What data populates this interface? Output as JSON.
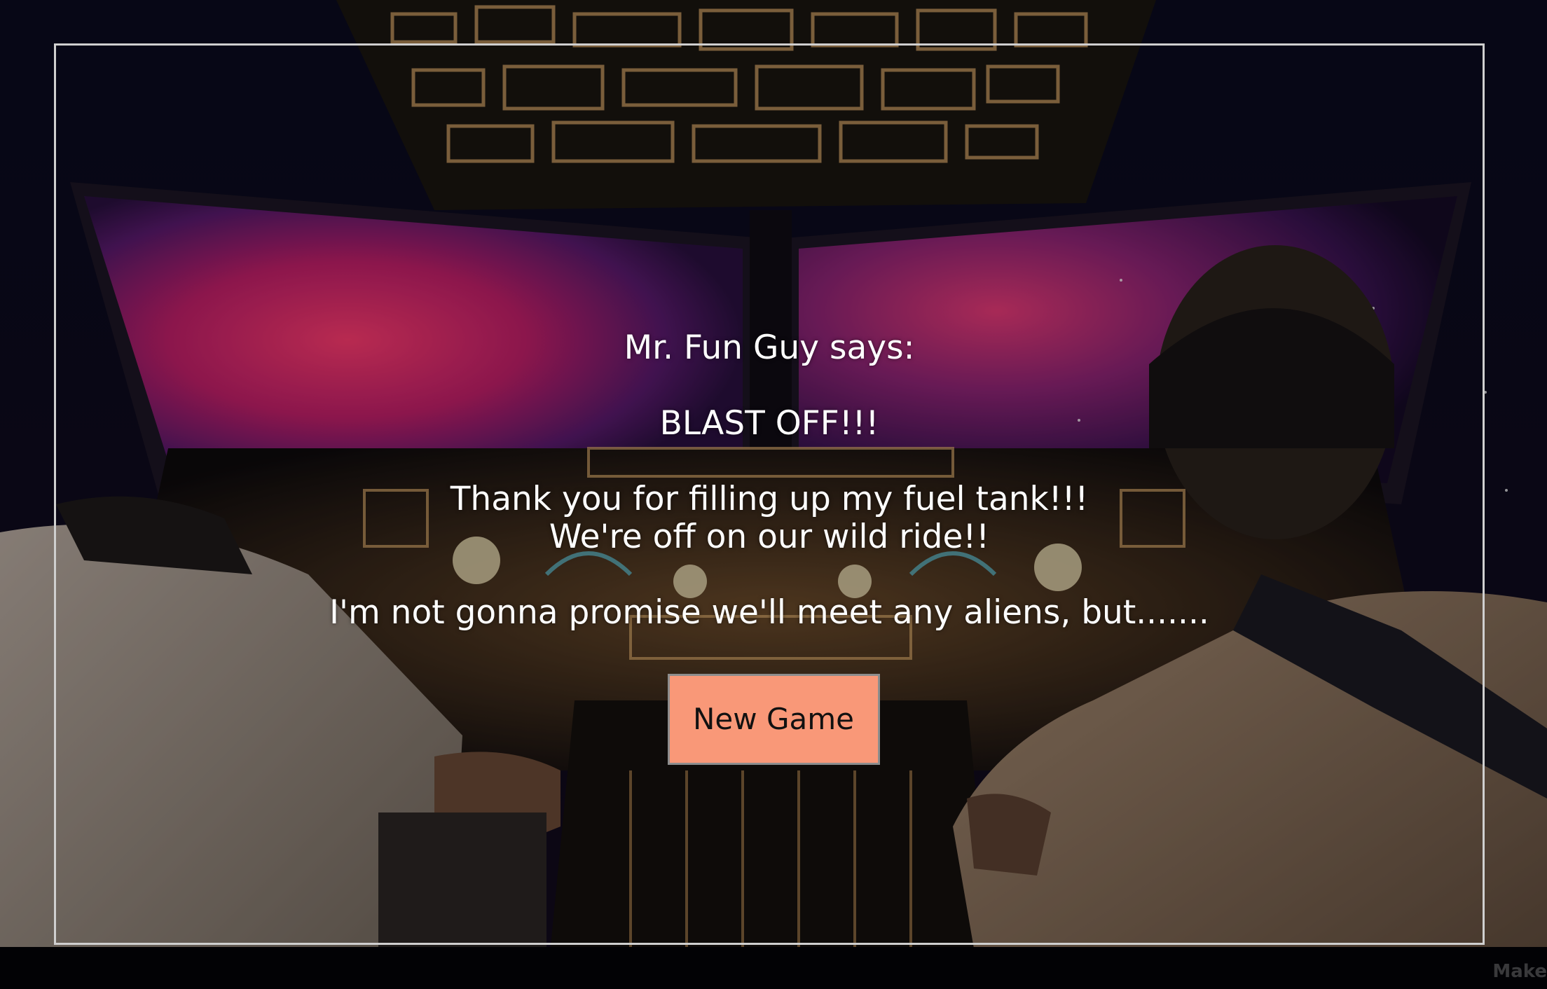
{
  "dialog": {
    "speaker": "Mr. Fun Guy says:",
    "headline": "BLAST OFF!!!",
    "line1": "Thank you for filling up my fuel tank!!!",
    "line2": "We're off on our wild ride!!",
    "line3": "I'm not gonna promise we'll meet any aliens, but......."
  },
  "actions": {
    "new_game_label": "New Game"
  },
  "watermark": {
    "text": "Make"
  },
  "colors": {
    "button_bg": "#f99878",
    "frame_border": "#cfcfcf",
    "text": "#ffffff"
  }
}
